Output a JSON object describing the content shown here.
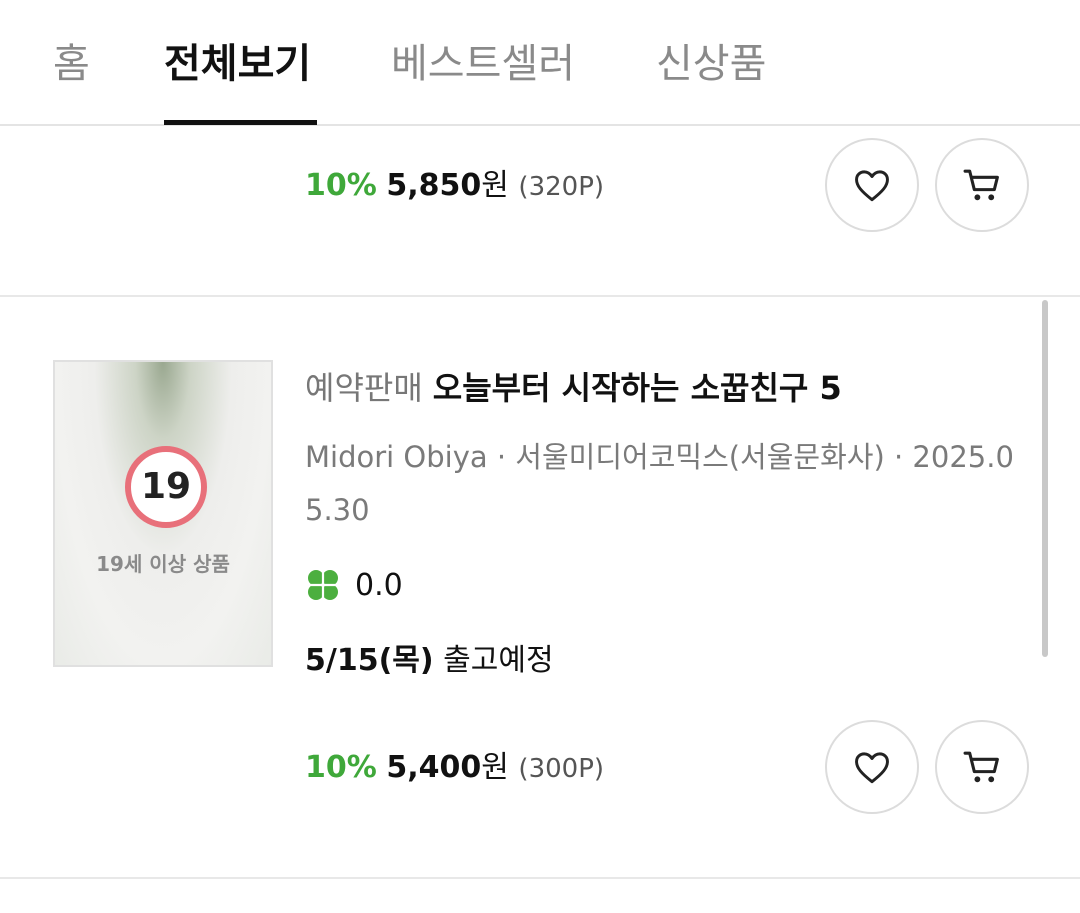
{
  "tabs": [
    {
      "label": "홈",
      "active": false
    },
    {
      "label": "전체보기",
      "active": true
    },
    {
      "label": "베스트셀러",
      "active": false
    },
    {
      "label": "신상품",
      "active": false
    }
  ],
  "items": [
    {
      "discount": "10%",
      "price": "5,850",
      "currency": "원",
      "points": "(320P)"
    },
    {
      "cover_age_number": "19",
      "cover_age_text": "19세 이상 상품",
      "badge": "예약판매",
      "title": "오늘부터 시작하는 소꿉친구 5",
      "meta": "Midori Obiya · 서울미디어코믹스(서울문화사) · 2025.05.30",
      "rating": "0.0",
      "ship_date": "5/15(목)",
      "ship_label": "출고예정",
      "discount": "10%",
      "price": "5,400",
      "currency": "원",
      "points": "(300P)"
    }
  ],
  "icons": {
    "wishlist": "heart-icon",
    "cart": "cart-icon",
    "rating": "clover-icon"
  },
  "colors": {
    "discount": "#3fa83a",
    "rating_icon": "#4caf3f",
    "age_ring": "#e8707a",
    "active_tab": "#111111",
    "inactive_tab": "#8a8a8a"
  }
}
